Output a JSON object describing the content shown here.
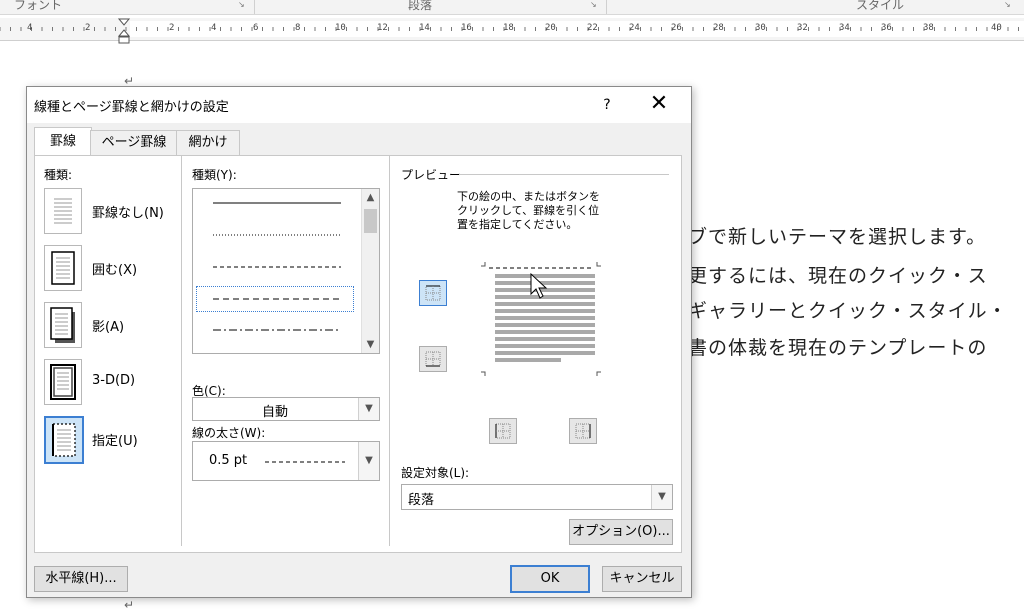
{
  "ribbon": {
    "groups": [
      "フォント",
      "段落",
      "スタイル"
    ]
  },
  "ruler": {
    "numbers": [
      "4",
      "2",
      "2",
      "4",
      "6",
      "8",
      "10",
      "12",
      "14",
      "16",
      "18",
      "20",
      "22",
      "24",
      "26",
      "28",
      "30",
      "32",
      "34",
      "36",
      "38",
      "40"
    ]
  },
  "document": {
    "lines": [
      "ブで新しいテーマを選択します。",
      "更するには、現在のクイック・ス",
      "ギャラリーとクイック・スタイル・",
      "書の体裁を現在のテンプレートの"
    ]
  },
  "dialog": {
    "title": "線種とページ罫線と網かけの設定",
    "help": "?",
    "close": "✕",
    "tabs": [
      "罫線",
      "ページ罫線",
      "網かけ"
    ],
    "setting_label": "種類:",
    "settings": [
      {
        "label": "罫線なし(N)"
      },
      {
        "label": "囲む(X)"
      },
      {
        "label": "影(A)"
      },
      {
        "label": "3-D(D)"
      },
      {
        "label": "指定(U)"
      }
    ],
    "style_label": "種類(Y):",
    "color_label": "色(C):",
    "color_value": "自動",
    "width_label": "線の太さ(W):",
    "width_value": "0.5 pt",
    "preview_label": "プレビュー",
    "preview_instruction": [
      "下の絵の中、またはボタンを",
      "クリックして、罫線を引く位",
      "置を指定してください。"
    ],
    "apply_label": "設定対象(L):",
    "apply_value": "段落",
    "options_button": "オプション(O)...",
    "horizontal_line_button": "水平線(H)...",
    "ok_button": "OK",
    "cancel_button": "キャンセル"
  },
  "colors": {
    "accent": "#3c7fd2",
    "dialog_bg": "#f0f0f0"
  }
}
